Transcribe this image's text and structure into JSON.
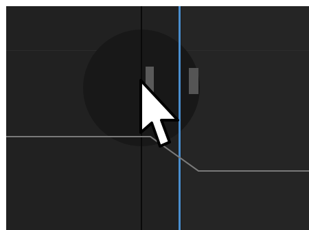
{
  "canvas": {
    "background_color": "#212121",
    "selection_color": "#4a8fd0",
    "guide_color": "#7a7a7a"
  },
  "cursor": {
    "icon": "arrow-pointer-icon",
    "fill_color": "#ffffff",
    "outline_color": "#000000"
  }
}
